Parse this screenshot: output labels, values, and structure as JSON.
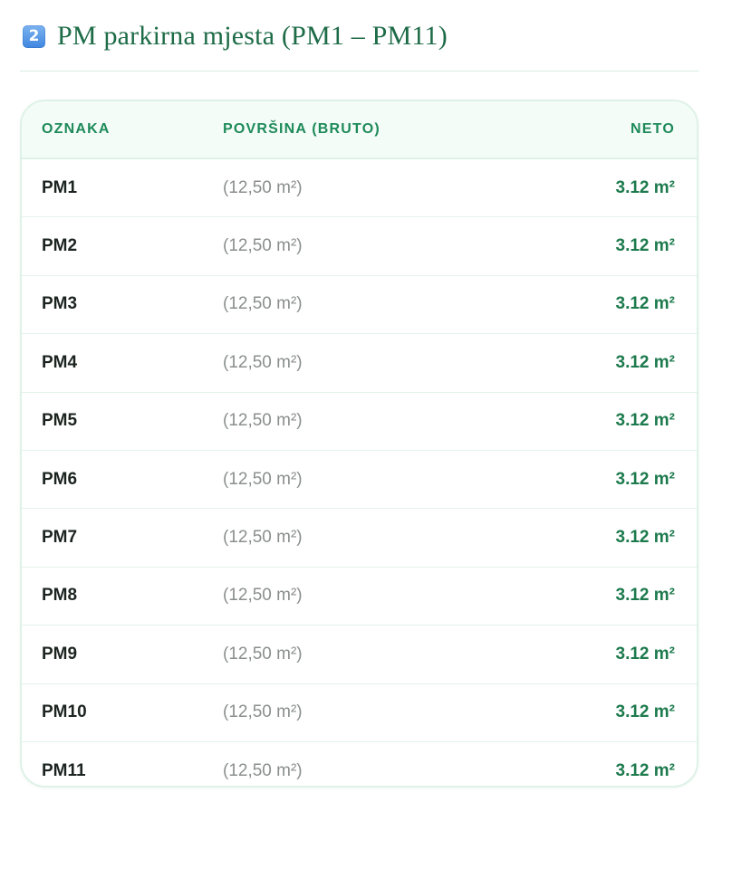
{
  "section": {
    "step_number": "2",
    "title": "PM parkirna mjesta (PM1 – PM11)"
  },
  "table": {
    "headers": {
      "oznaka": "OZNAKA",
      "povrsina": "POVRŠINA (BRUTO)",
      "neto": "NETO"
    },
    "rows": [
      {
        "oznaka": "PM1",
        "povrsina": "(12,50 m²)",
        "neto": "3.12 m²"
      },
      {
        "oznaka": "PM2",
        "povrsina": "(12,50 m²)",
        "neto": "3.12 m²"
      },
      {
        "oznaka": "PM3",
        "povrsina": "(12,50 m²)",
        "neto": "3.12 m²"
      },
      {
        "oznaka": "PM4",
        "povrsina": "(12,50 m²)",
        "neto": "3.12 m²"
      },
      {
        "oznaka": "PM5",
        "povrsina": "(12,50 m²)",
        "neto": "3.12 m²"
      },
      {
        "oznaka": "PM6",
        "povrsina": "(12,50 m²)",
        "neto": "3.12 m²"
      },
      {
        "oznaka": "PM7",
        "povrsina": "(12,50 m²)",
        "neto": "3.12 m²"
      },
      {
        "oznaka": "PM8",
        "povrsina": "(12,50 m²)",
        "neto": "3.12 m²"
      },
      {
        "oznaka": "PM9",
        "povrsina": "(12,50 m²)",
        "neto": "3.12 m²"
      },
      {
        "oznaka": "PM10",
        "povrsina": "(12,50 m²)",
        "neto": "3.12 m²"
      },
      {
        "oznaka": "PM11",
        "povrsina": "(12,50 m²)",
        "neto": "3.12 m²"
      }
    ]
  },
  "colors": {
    "accent_green": "#1d6b47",
    "header_green": "#1e8a5a",
    "value_green": "#1d7a4d",
    "badge_blue": "#3f86e0",
    "muted_text": "#8a8f8c"
  },
  "icons": {
    "step_badge": "number-2-keycap-icon"
  }
}
